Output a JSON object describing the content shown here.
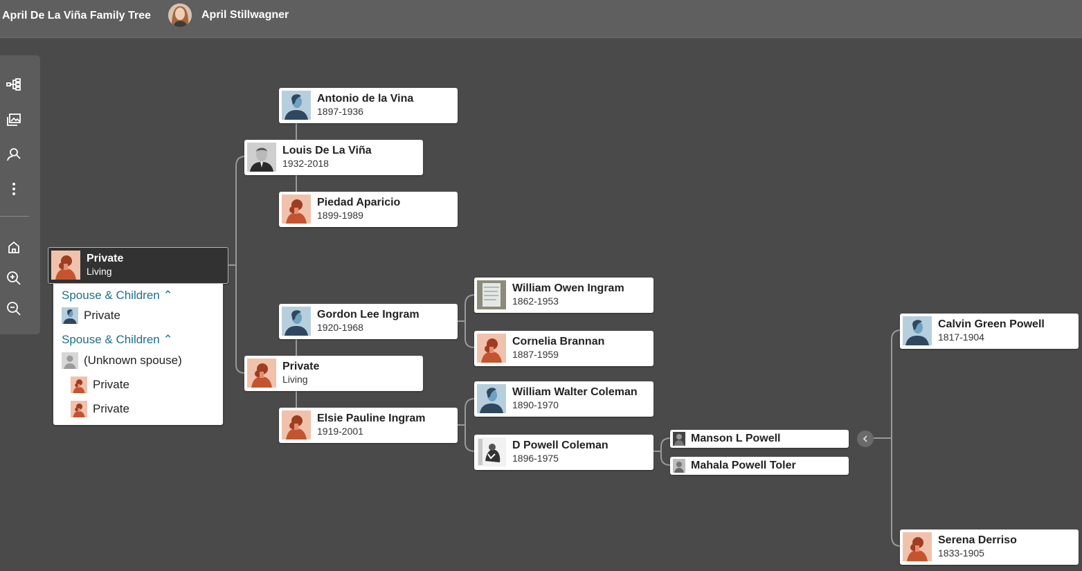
{
  "header": {
    "tree_title": "April De La Viña Family Tree",
    "owner_name": "April Stillwagner"
  },
  "toolbar": {
    "items": [
      {
        "icon": "tree-view-icon"
      },
      {
        "icon": "media-gallery-icon"
      },
      {
        "icon": "person-search-icon"
      },
      {
        "icon": "more-options-icon"
      },
      {
        "icon": "home-icon"
      },
      {
        "icon": "zoom-in-icon"
      },
      {
        "icon": "zoom-out-icon"
      }
    ]
  },
  "focus": {
    "name": "Private",
    "years": "Living"
  },
  "panel": {
    "spouse_children_label": "Spouse & Children",
    "spouse_1": "Private",
    "spouse_2": "(Unknown spouse)",
    "child_1": "Private",
    "child_2": "Private"
  },
  "people": {
    "antonio": {
      "name": "Antonio de la Vina",
      "years": "1897-1936"
    },
    "louis": {
      "name": "Louis De La Viña",
      "years": "1932-2018"
    },
    "piedad": {
      "name": "Piedad Aparicio",
      "years": "1899-1989"
    },
    "gordon": {
      "name": "Gordon Lee Ingram",
      "years": "1920-1968"
    },
    "mother": {
      "name": "Private",
      "years": "Living"
    },
    "elsie": {
      "name": "Elsie Pauline Ingram",
      "years": "1919-2001"
    },
    "william_owen": {
      "name": "William Owen Ingram",
      "years": "1862-1953"
    },
    "cornelia": {
      "name": "Cornelia Brannan",
      "years": "1887-1959"
    },
    "william_walter": {
      "name": "William Walter Coleman",
      "years": "1890-1970"
    },
    "d_powell": {
      "name": "D Powell Coleman",
      "years": "1896-1975"
    },
    "manson": {
      "name": "Manson L Powell"
    },
    "mahala": {
      "name": "Mahala Powell Toler"
    },
    "calvin": {
      "name": "Calvin Green Powell",
      "years": "1817-1904"
    },
    "serena": {
      "name": "Serena Derriso",
      "years": "1833-1905"
    }
  },
  "colors": {
    "background": "#4a4a4a",
    "header": "#5f5f5f",
    "link": "#1a6f8f",
    "male_avatar_bg": "#b7cedd",
    "female_avatar_bg": "#f0c2ac"
  }
}
